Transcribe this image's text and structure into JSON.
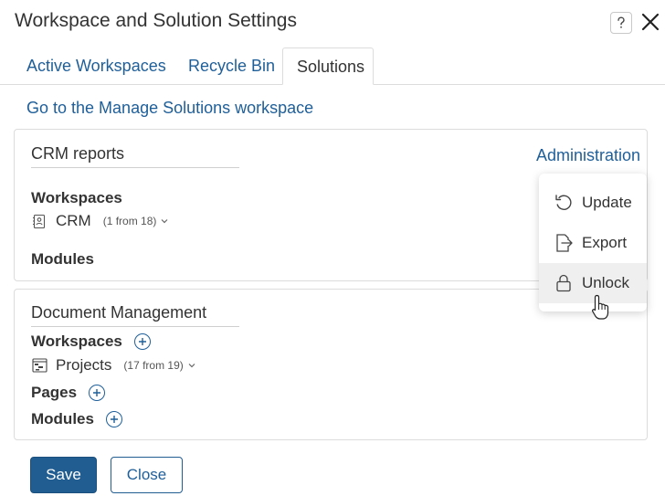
{
  "window": {
    "title": "Workspace and Solution Settings",
    "help_label": "?"
  },
  "tabs": [
    {
      "label": "Active Workspaces"
    },
    {
      "label": "Recycle Bin"
    },
    {
      "label": "Solutions",
      "active": true
    }
  ],
  "manage_link": "Go to the Manage Solutions workspace",
  "solutions": [
    {
      "name": "CRM reports",
      "admin_label": "Administration",
      "workspaces_label": "Workspaces",
      "workspace": {
        "name": "CRM",
        "count": "(1 from 18)"
      },
      "modules_label": "Modules"
    },
    {
      "name": "Document Management",
      "workspaces_label": "Workspaces",
      "workspace": {
        "name": "Projects",
        "count": "(17 from 19)"
      },
      "pages_label": "Pages",
      "modules_label": "Modules"
    }
  ],
  "dropdown": {
    "items": [
      {
        "label": "Update",
        "icon": "refresh-icon"
      },
      {
        "label": "Export",
        "icon": "export-icon"
      },
      {
        "label": "Unlock",
        "icon": "lock-icon",
        "hovered": true
      }
    ]
  },
  "footer": {
    "save_label": "Save",
    "close_label": "Close"
  },
  "colors": {
    "link": "#1f5f99",
    "primary_button": "#215d91",
    "text": "#333333"
  }
}
